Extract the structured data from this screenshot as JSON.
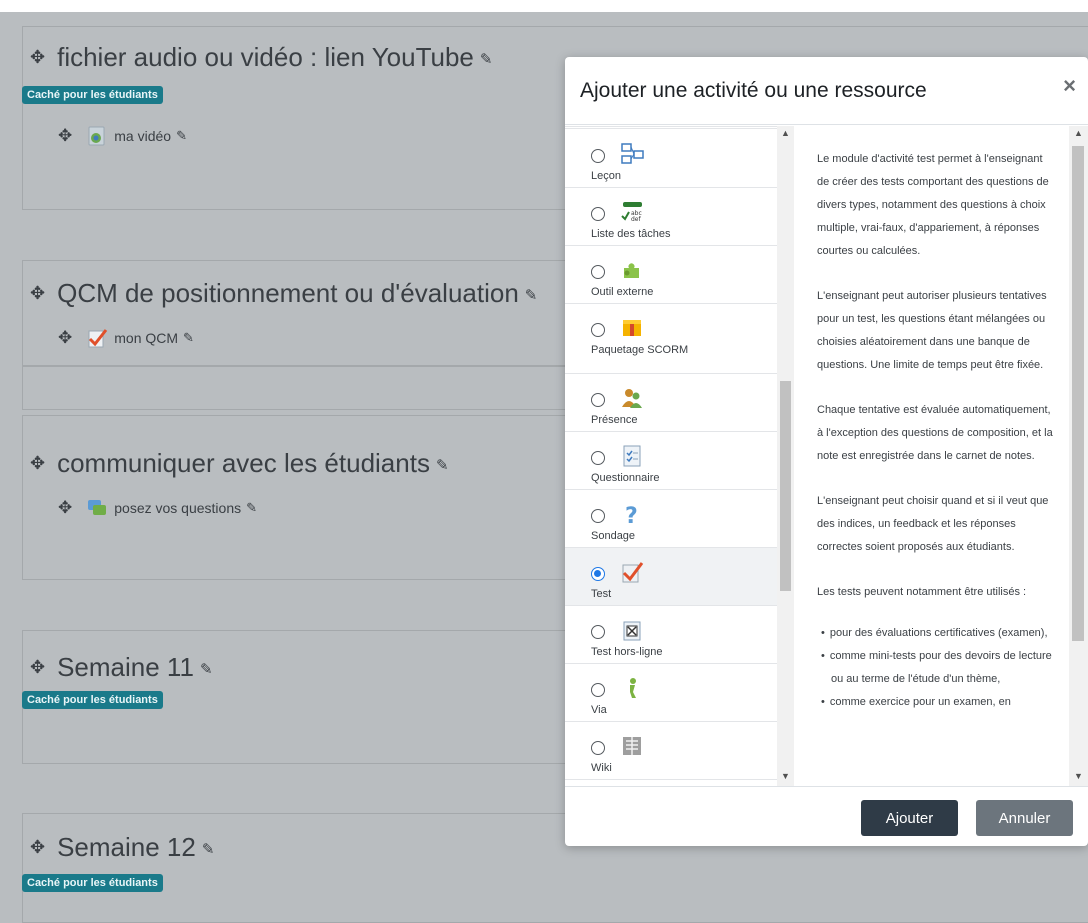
{
  "sections": [
    {
      "title": "fichier audio ou vidéo : lien YouTube",
      "badge": "Caché pour les étudiants",
      "activities": [
        {
          "label": "ma vidéo",
          "icon": "video-icon"
        }
      ]
    },
    {
      "title": "QCM de positionnement ou d'évaluation",
      "badge": "",
      "activities": [
        {
          "label": "mon QCM",
          "icon": "quiz-icon"
        }
      ]
    },
    {
      "title": "communiquer avec les étudiants",
      "badge": "",
      "activities": [
        {
          "label": "posez vos questions",
          "icon": "forum-icon"
        }
      ]
    },
    {
      "title": "Semaine 11",
      "badge": "Caché pour les étudiants",
      "activities": []
    },
    {
      "title": "Semaine 12",
      "badge": "Caché pour les étudiants",
      "activities": []
    }
  ],
  "modal": {
    "title": "Ajouter une activité ou une ressource",
    "close": "×",
    "options": [
      {
        "label": "Leçon",
        "icon": "lesson-icon",
        "selected": false
      },
      {
        "label": "Liste des tâches",
        "icon": "checklist-icon",
        "selected": false
      },
      {
        "label": "Outil externe",
        "icon": "puzzle-icon",
        "selected": false
      },
      {
        "label": "Paquetage SCORM",
        "icon": "scorm-package-icon",
        "selected": false
      },
      {
        "label": "Présence",
        "icon": "attendance-icon",
        "selected": false
      },
      {
        "label": "Questionnaire",
        "icon": "questionnaire-icon",
        "selected": false
      },
      {
        "label": "Sondage",
        "icon": "question-mark-icon",
        "selected": false
      },
      {
        "label": "Test",
        "icon": "quiz-icon",
        "selected": true
      },
      {
        "label": "Test hors-ligne",
        "icon": "offline-quiz-icon",
        "selected": false
      },
      {
        "label": "Via",
        "icon": "via-icon",
        "selected": false
      },
      {
        "label": "Wiki",
        "icon": "wiki-icon",
        "selected": false
      }
    ],
    "description": {
      "paragraphs": [
        "Le module d'activité test permet à l'enseignant de créer des tests comportant des questions de divers types, notamment des questions à choix multiple, vrai-faux, d'appariement, à réponses courtes ou calculées.",
        "L'enseignant peut autoriser plusieurs tentatives pour un test, les questions étant mélangées ou choisies aléatoirement dans une banque de questions. Une limite de temps peut être fixée.",
        "Chaque tentative est évaluée automatiquement, à l'exception des questions de composition, et la note est enregistrée dans le carnet de notes.",
        "L'enseignant peut choisir quand et si il veut que des indices, un feedback et les réponses correctes soient proposés aux étudiants.",
        "Les tests peuvent notamment être utilisés :"
      ],
      "bullets": [
        "pour des évaluations certificatives (examen),",
        "comme mini-tests pour des devoirs de lecture ou au terme de l'étude d'un thème,",
        "comme exercice pour un examen, en"
      ]
    },
    "buttons": {
      "add": "Ajouter",
      "cancel": "Annuler"
    }
  },
  "colors": {
    "badge": "#1a7a8a",
    "primary_button": "#2f3b47",
    "secondary_button": "#6c757d",
    "radio_selected": "#1e78e6",
    "backdrop": "#b9bdc0"
  }
}
